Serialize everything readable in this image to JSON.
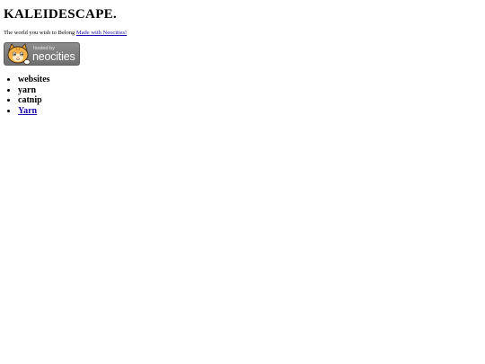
{
  "header": {
    "title": "KALEIDESCAPE."
  },
  "tagline": {
    "text": "The world you wish to Belong",
    "link_label": "Made with Neocities!"
  },
  "badge": {
    "small_text": "hosted by",
    "big_text": "neocities",
    "icon": "neocities-cat-icon"
  },
  "nav": {
    "items": [
      {
        "label": "websites",
        "link": false
      },
      {
        "label": "yarn",
        "link": false
      },
      {
        "label": "catnip",
        "link": false
      },
      {
        "label": "Yarn",
        "link": true
      }
    ]
  },
  "colors": {
    "link": "#1a0dab",
    "badge_bg": "#7a7a7a",
    "text": "#000000"
  }
}
